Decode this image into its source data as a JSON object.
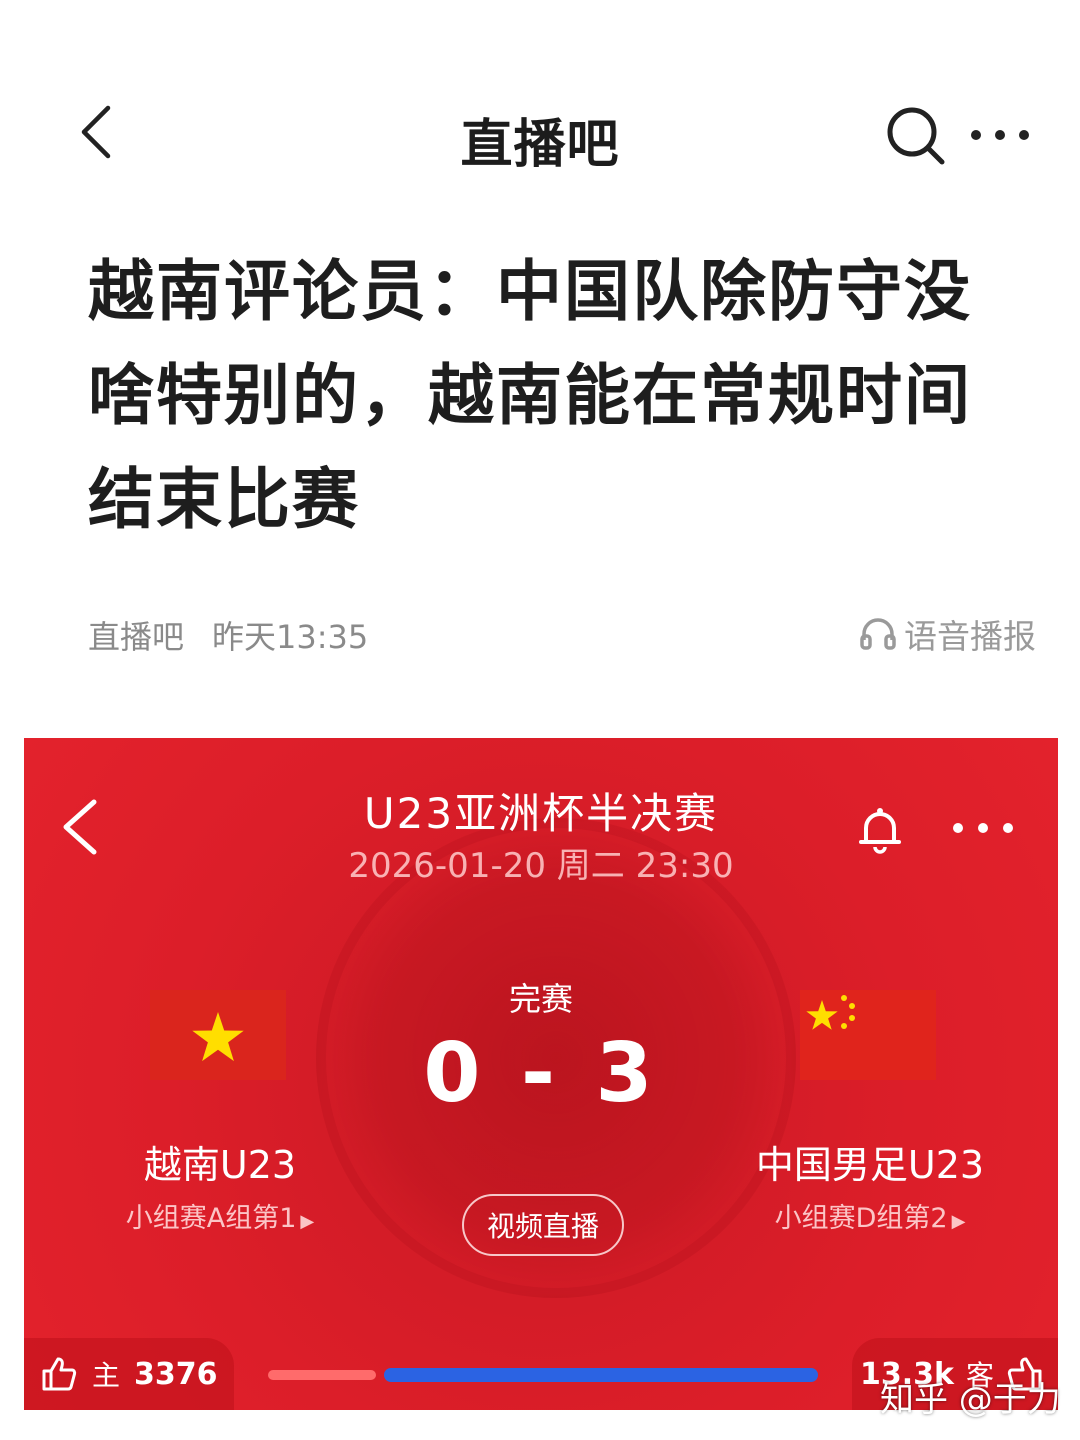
{
  "nav": {
    "title": "直播吧"
  },
  "article": {
    "headline": "越南评论员：中国队除防守没啥特别的，越南能在常规时间结束比赛",
    "source": "直播吧",
    "time": "昨天13:35",
    "audio_label": "语音播报"
  },
  "match": {
    "title": "U23亚洲杯半决赛",
    "datetime": "2026-01-20 周二 23:30",
    "status": "完赛",
    "score": "0 - 3",
    "home": {
      "name": "越南U23",
      "rank": "小组赛A组第1",
      "flag": "vietnam-flag"
    },
    "away": {
      "name": "中国男足U23",
      "rank": "小组赛D组第2",
      "flag": "china-flag"
    },
    "video_label": "视频直播",
    "vote": {
      "home_label": "主",
      "home_count": "3376",
      "away_label": "客",
      "away_count": "13.3k"
    }
  },
  "watermark": "知乎 @于力",
  "colors": {
    "card_red": "#dc1e29",
    "vote_blue": "#2b63e3",
    "vote_red": "#ff6b6b",
    "flag_yellow": "#ffde00"
  }
}
